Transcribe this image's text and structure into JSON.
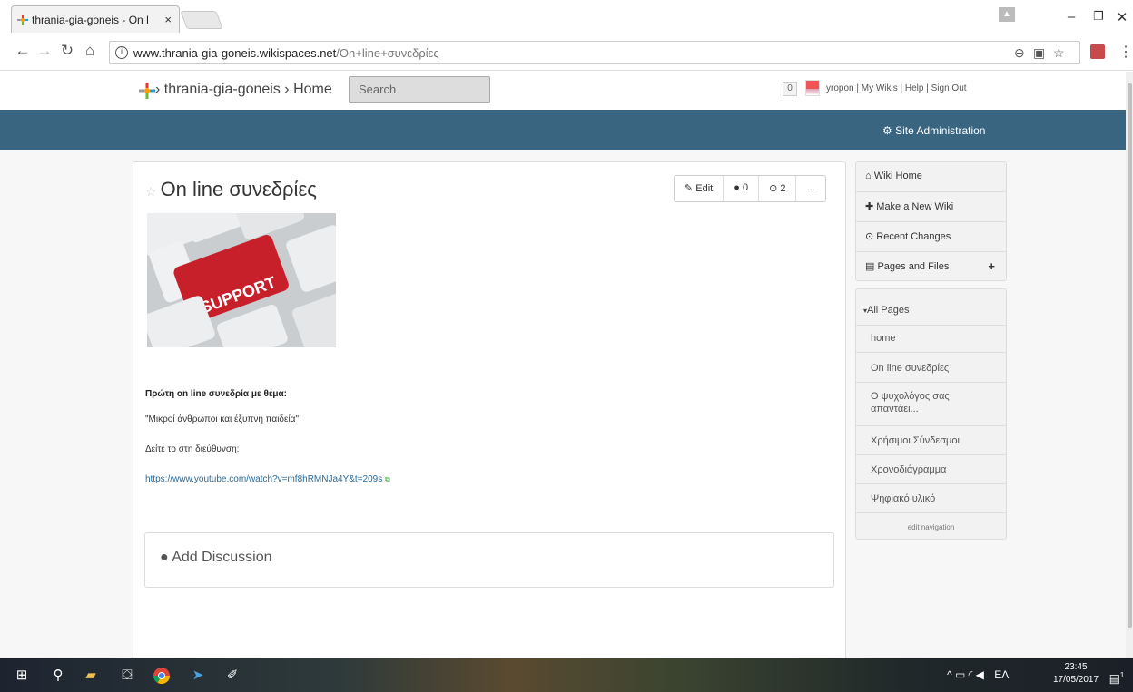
{
  "browser": {
    "tab_title": "thrania-gia-goneis - On l",
    "tab_close": "×",
    "url_host": "www.thrania-gia-goneis.wikispaces.net",
    "url_path": "/On+line+συνεδρίες"
  },
  "wiki": {
    "breadcrumb": "› thrania-gia-goneis › Home",
    "search_placeholder": "Search",
    "notification_count": "0",
    "user": "yropon",
    "links": [
      "My Wikis",
      "Help",
      "Sign Out"
    ],
    "site_admin": "Site Administration"
  },
  "page": {
    "title": "On line συνεδρίες",
    "edit_label": "Edit",
    "comments_count": "0",
    "history_count": "2",
    "more_label": "...",
    "image_text": "SUPPORT",
    "para1": "Πρώτη on line συνεδρία με θέμα:",
    "para2": "\"Μικροί άνθρωποι και έξυπνη παιδεία\"",
    "para3": "Δείτε το στη διεύθυνση:",
    "link": "https://www.youtube.com/watch?v=mf8hRMNJa4Y&t=209s",
    "add_discussion": "Add Discussion"
  },
  "sidebar": {
    "wiki_home": "Wiki Home",
    "make_wiki": "Make a New Wiki",
    "recent_changes": "Recent Changes",
    "pages_files": "Pages and Files",
    "all_pages": "All Pages",
    "nav": [
      "home",
      "On line συνεδρίες",
      "Ο ψυχολόγος σας απαντάει...",
      "Χρήσιμοι Σύνδεσμοι",
      "Χρονοδιάγραμμα",
      "Ψηφιακό υλικό"
    ],
    "edit_navigation": "edit navigation"
  },
  "taskbar": {
    "lang": "ΕΛ",
    "time": "23:45",
    "date": "17/05/2017",
    "notification_badge": "1"
  },
  "colors": {
    "header_bar": "#3a6580",
    "link": "#2a6a9a",
    "support_key": "#c8202a"
  }
}
